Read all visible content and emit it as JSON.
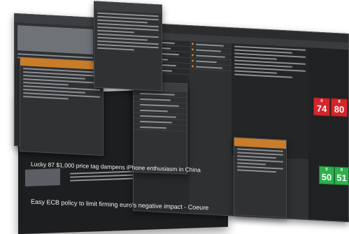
{
  "news": {
    "headline_1": "Lucky 87 $1,000 price tag dampens iPhone enthusiasm in China",
    "headline_2": "Easy ECB policy to limit firming euro's negative impact - Coeure"
  },
  "prices": {
    "tile_1": {
      "big": "74",
      "small": "0"
    },
    "tile_2": {
      "big": "80",
      "small": "8"
    },
    "tile_3": {
      "big": "50",
      "small": "5"
    },
    "tile_4": {
      "big": "51",
      "small": "0"
    }
  },
  "colors": {
    "background": "#ffffff",
    "panel": "#2f3133",
    "accent_orange": "#c97d2a",
    "price_up": "#2bb24c",
    "price_down": "#d3262b"
  }
}
